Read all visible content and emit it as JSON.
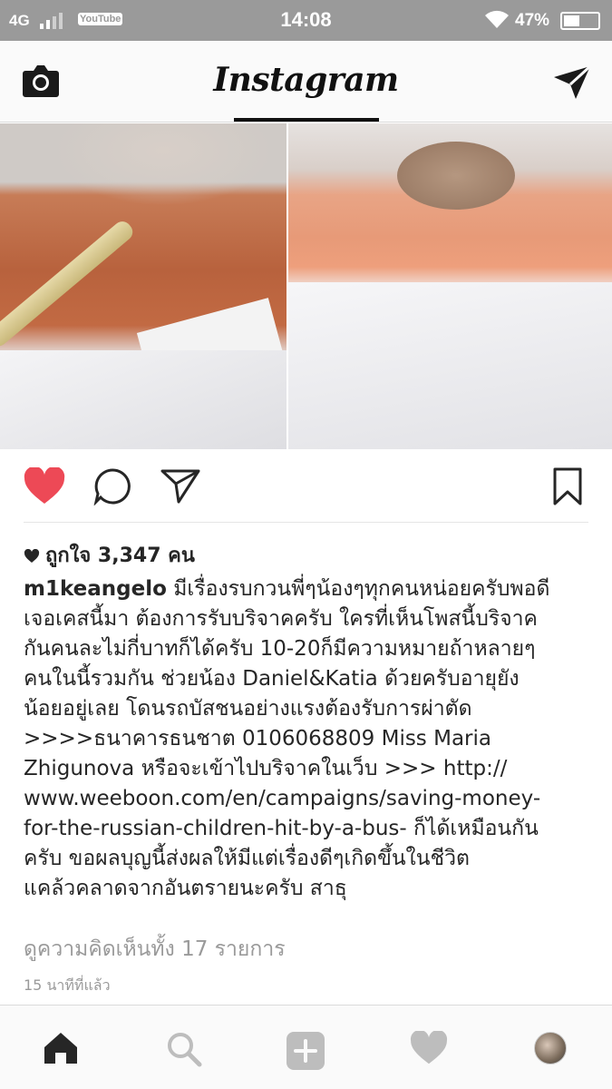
{
  "status_bar": {
    "network": "4G",
    "app_badge": "YouTube",
    "time": "14:08",
    "battery_percent_text": "47%",
    "battery_level": 0.47,
    "color": "#9a9a9a"
  },
  "header": {
    "logo": "Instagram",
    "left_icon": "camera-icon",
    "right_icon": "direct-send-icon"
  },
  "post": {
    "image_alt_icons": [
      "photo-left",
      "photo-right"
    ],
    "actions": {
      "like_icon": "heart-filled-icon",
      "comment_icon": "comment-icon",
      "share_icon": "send-icon",
      "save_icon": "bookmark-icon",
      "like_color": "#ed4956"
    },
    "likes_text": "ถูกใจ 3,347 คน",
    "username": "m1keangelo",
    "caption_lines": [
      "มีเรื่องรบกวนพี่ๆน้องๆทุกคนหน่อยครับพอดี",
      "เจอเคสนี้มา ต้องการรับบริจาคครับ ใครที่เห็นโพสนี้บริจาค",
      "กันคนละไม่กี่บาทก็ได้ครับ 10-20ก็มีความหมายถ้าหลายๆ",
      "คนในนี้รวมกัน ช่วยน้อง Daniel&Katia ด้วยครับอายุยัง",
      "น้อยอยู่เลย โดนรถบัสชนอย่างแรงต้องรับการผ่าตัด",
      ">>>>ธนาคารธนชาต 0106068809 Miss Maria",
      "Zhigunova หรือจะเข้าไปบริจาคในเว็บ >>> http://",
      "www.weeboon.com/en/campaigns/saving-money-",
      "for-the-russian-children-hit-by-a-bus- ก็ได้เหมือนกัน",
      "ครับ ขอผลบุญนี้ส่งผลให้มีแต่เรื่องดีๆเกิดขึ้นในชีวิต",
      "แคล้วคลาดจากอันตรายนะครับ สาธุ"
    ],
    "view_comments": "ดูความคิดเห็นทั้ง 17 รายการ",
    "time_ago": "15 นาทีที่แล้ว"
  },
  "bottom_nav": {
    "items": [
      "home-icon",
      "search-icon",
      "add-post-icon",
      "activity-heart-icon",
      "profile-avatar"
    ]
  }
}
